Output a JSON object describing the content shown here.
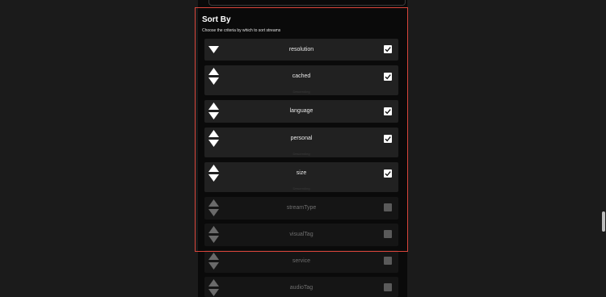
{
  "section": {
    "title": "Sort By",
    "subtitle": "Choose the criteria by which to sort streams"
  },
  "criteria": [
    {
      "label": "resolution",
      "order": "",
      "checked": true,
      "enabled": true
    },
    {
      "label": "cached",
      "order": "Descending",
      "checked": true,
      "enabled": true
    },
    {
      "label": "language",
      "order": "",
      "checked": true,
      "enabled": true
    },
    {
      "label": "personal",
      "order": "Descending",
      "checked": true,
      "enabled": true
    },
    {
      "label": "size",
      "order": "Descending",
      "checked": true,
      "enabled": true
    },
    {
      "label": "streamType",
      "order": "",
      "checked": false,
      "enabled": false
    },
    {
      "label": "visualTag",
      "order": "",
      "checked": false,
      "enabled": false
    },
    {
      "label": "service",
      "order": "",
      "checked": false,
      "enabled": false
    },
    {
      "label": "audioTag",
      "order": "",
      "checked": false,
      "enabled": false
    }
  ],
  "colors": {
    "highlight": "#d9453b",
    "row_bg": "#212121",
    "row_disabled_bg": "#151515"
  },
  "icons": {
    "reorder": "up-down-arrows-icon",
    "move_down": "arrow-down-icon",
    "checkbox": "checkmark-icon"
  }
}
